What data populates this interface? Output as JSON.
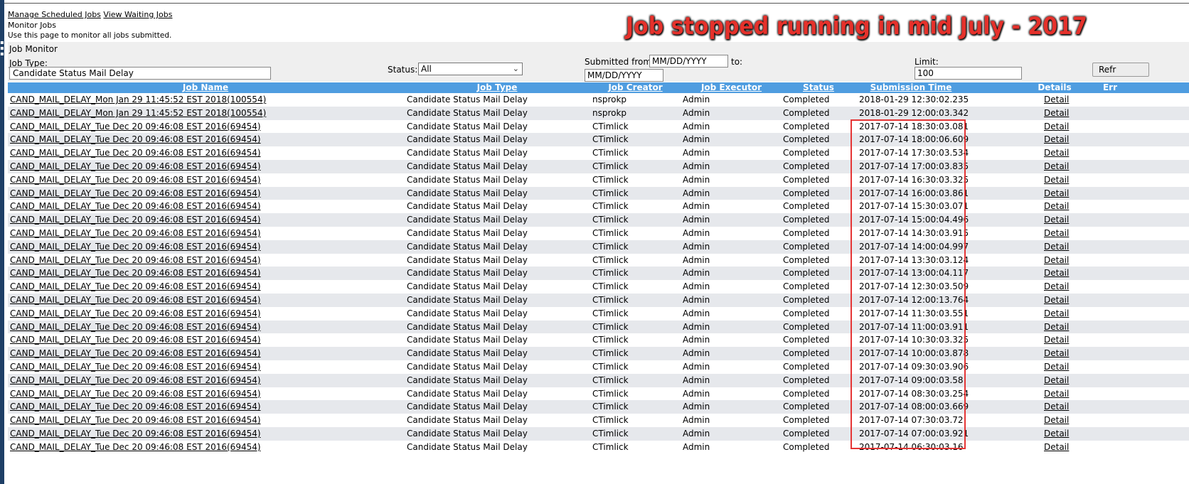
{
  "nav": {
    "manage_scheduled_jobs": "Manage Scheduled Jobs",
    "view_waiting_jobs": "View Waiting Jobs"
  },
  "page": {
    "subtitle": "Monitor Jobs",
    "description": "Use this page to monitor all jobs submitted."
  },
  "annotation": {
    "text": "Job stopped running in mid July - 2017",
    "color": "#e5312b"
  },
  "filters": {
    "panel_title": "Job Monitor",
    "job_type_label": "Job Type:",
    "job_type_value": "Candidate Status Mail Delay",
    "status_label": "Status:",
    "status_value": "All",
    "submitted_from_label": "Submitted from:",
    "submitted_from_value": "MM/DD/YYYY",
    "to_label": "to:",
    "to_value": "MM/DD/YYYY",
    "limit_label": "Limit:",
    "limit_value": "100",
    "refresh_label": "Refr"
  },
  "table": {
    "header_color": "#4f9de0",
    "columns": {
      "job_name": "Job Name",
      "job_type": "Job Type",
      "job_creator": "Job Creator",
      "job_executor": "Job Executor",
      "status": "Status",
      "submission_time": "Submission Time",
      "details": "Details",
      "errors": "Err"
    },
    "rows": [
      {
        "job_name": "CAND_MAIL_DELAY_Mon Jan 29 11:45:52 EST 2018(100554)",
        "job_type": "Candidate Status Mail Delay",
        "creator": "nsprokp",
        "executor": "Admin",
        "status": "Completed",
        "time": "2018-01-29 12:30:02.235",
        "details": "Detail"
      },
      {
        "job_name": "CAND_MAIL_DELAY_Mon Jan 29 11:45:52 EST 2018(100554)",
        "job_type": "Candidate Status Mail Delay",
        "creator": "nsprokp",
        "executor": "Admin",
        "status": "Completed",
        "time": "2018-01-29 12:00:03.342",
        "details": "Detail"
      },
      {
        "job_name": "CAND_MAIL_DELAY_Tue Dec 20 09:46:08 EST 2016(69454)",
        "job_type": "Candidate Status Mail Delay",
        "creator": "CTimlick",
        "executor": "Admin",
        "status": "Completed",
        "time": "2017-07-14 18:30:03.081",
        "details": "Detail"
      },
      {
        "job_name": "CAND_MAIL_DELAY_Tue Dec 20 09:46:08 EST 2016(69454)",
        "job_type": "Candidate Status Mail Delay",
        "creator": "CTimlick",
        "executor": "Admin",
        "status": "Completed",
        "time": "2017-07-14 18:00:06.609",
        "details": "Detail"
      },
      {
        "job_name": "CAND_MAIL_DELAY_Tue Dec 20 09:46:08 EST 2016(69454)",
        "job_type": "Candidate Status Mail Delay",
        "creator": "CTimlick",
        "executor": "Admin",
        "status": "Completed",
        "time": "2017-07-14 17:30:03.534",
        "details": "Detail"
      },
      {
        "job_name": "CAND_MAIL_DELAY_Tue Dec 20 09:46:08 EST 2016(69454)",
        "job_type": "Candidate Status Mail Delay",
        "creator": "CTimlick",
        "executor": "Admin",
        "status": "Completed",
        "time": "2017-07-14 17:00:03.835",
        "details": "Detail"
      },
      {
        "job_name": "CAND_MAIL_DELAY_Tue Dec 20 09:46:08 EST 2016(69454)",
        "job_type": "Candidate Status Mail Delay",
        "creator": "CTimlick",
        "executor": "Admin",
        "status": "Completed",
        "time": "2017-07-14 16:30:03.325",
        "details": "Detail"
      },
      {
        "job_name": "CAND_MAIL_DELAY_Tue Dec 20 09:46:08 EST 2016(69454)",
        "job_type": "Candidate Status Mail Delay",
        "creator": "CTimlick",
        "executor": "Admin",
        "status": "Completed",
        "time": "2017-07-14 16:00:03.861",
        "details": "Detail"
      },
      {
        "job_name": "CAND_MAIL_DELAY_Tue Dec 20 09:46:08 EST 2016(69454)",
        "job_type": "Candidate Status Mail Delay",
        "creator": "CTimlick",
        "executor": "Admin",
        "status": "Completed",
        "time": "2017-07-14 15:30:03.071",
        "details": "Detail"
      },
      {
        "job_name": "CAND_MAIL_DELAY_Tue Dec 20 09:46:08 EST 2016(69454)",
        "job_type": "Candidate Status Mail Delay",
        "creator": "CTimlick",
        "executor": "Admin",
        "status": "Completed",
        "time": "2017-07-14 15:00:04.496",
        "details": "Detail"
      },
      {
        "job_name": "CAND_MAIL_DELAY_Tue Dec 20 09:46:08 EST 2016(69454)",
        "job_type": "Candidate Status Mail Delay",
        "creator": "CTimlick",
        "executor": "Admin",
        "status": "Completed",
        "time": "2017-07-14 14:30:03.915",
        "details": "Detail"
      },
      {
        "job_name": "CAND_MAIL_DELAY_Tue Dec 20 09:46:08 EST 2016(69454)",
        "job_type": "Candidate Status Mail Delay",
        "creator": "CTimlick",
        "executor": "Admin",
        "status": "Completed",
        "time": "2017-07-14 14:00:04.997",
        "details": "Detail"
      },
      {
        "job_name": "CAND_MAIL_DELAY_Tue Dec 20 09:46:08 EST 2016(69454)",
        "job_type": "Candidate Status Mail Delay",
        "creator": "CTimlick",
        "executor": "Admin",
        "status": "Completed",
        "time": "2017-07-14 13:30:03.124",
        "details": "Detail"
      },
      {
        "job_name": "CAND_MAIL_DELAY_Tue Dec 20 09:46:08 EST 2016(69454)",
        "job_type": "Candidate Status Mail Delay",
        "creator": "CTimlick",
        "executor": "Admin",
        "status": "Completed",
        "time": "2017-07-14 13:00:04.117",
        "details": "Detail"
      },
      {
        "job_name": "CAND_MAIL_DELAY_Tue Dec 20 09:46:08 EST 2016(69454)",
        "job_type": "Candidate Status Mail Delay",
        "creator": "CTimlick",
        "executor": "Admin",
        "status": "Completed",
        "time": "2017-07-14 12:30:03.509",
        "details": "Detail"
      },
      {
        "job_name": "CAND_MAIL_DELAY_Tue Dec 20 09:46:08 EST 2016(69454)",
        "job_type": "Candidate Status Mail Delay",
        "creator": "CTimlick",
        "executor": "Admin",
        "status": "Completed",
        "time": "2017-07-14 12:00:13.764",
        "details": "Detail"
      },
      {
        "job_name": "CAND_MAIL_DELAY_Tue Dec 20 09:46:08 EST 2016(69454)",
        "job_type": "Candidate Status Mail Delay",
        "creator": "CTimlick",
        "executor": "Admin",
        "status": "Completed",
        "time": "2017-07-14 11:30:03.551",
        "details": "Detail"
      },
      {
        "job_name": "CAND_MAIL_DELAY_Tue Dec 20 09:46:08 EST 2016(69454)",
        "job_type": "Candidate Status Mail Delay",
        "creator": "CTimlick",
        "executor": "Admin",
        "status": "Completed",
        "time": "2017-07-14 11:00:03.911",
        "details": "Detail"
      },
      {
        "job_name": "CAND_MAIL_DELAY_Tue Dec 20 09:46:08 EST 2016(69454)",
        "job_type": "Candidate Status Mail Delay",
        "creator": "CTimlick",
        "executor": "Admin",
        "status": "Completed",
        "time": "2017-07-14 10:30:03.325",
        "details": "Detail"
      },
      {
        "job_name": "CAND_MAIL_DELAY_Tue Dec 20 09:46:08 EST 2016(69454)",
        "job_type": "Candidate Status Mail Delay",
        "creator": "CTimlick",
        "executor": "Admin",
        "status": "Completed",
        "time": "2017-07-14 10:00:03.878",
        "details": "Detail"
      },
      {
        "job_name": "CAND_MAIL_DELAY_Tue Dec 20 09:46:08 EST 2016(69454)",
        "job_type": "Candidate Status Mail Delay",
        "creator": "CTimlick",
        "executor": "Admin",
        "status": "Completed",
        "time": "2017-07-14 09:30:03.906",
        "details": "Detail"
      },
      {
        "job_name": "CAND_MAIL_DELAY_Tue Dec 20 09:46:08 EST 2016(69454)",
        "job_type": "Candidate Status Mail Delay",
        "creator": "CTimlick",
        "executor": "Admin",
        "status": "Completed",
        "time": "2017-07-14 09:00:03.58",
        "details": "Detail"
      },
      {
        "job_name": "CAND_MAIL_DELAY_Tue Dec 20 09:46:08 EST 2016(69454)",
        "job_type": "Candidate Status Mail Delay",
        "creator": "CTimlick",
        "executor": "Admin",
        "status": "Completed",
        "time": "2017-07-14 08:30:03.254",
        "details": "Detail"
      },
      {
        "job_name": "CAND_MAIL_DELAY_Tue Dec 20 09:46:08 EST 2016(69454)",
        "job_type": "Candidate Status Mail Delay",
        "creator": "CTimlick",
        "executor": "Admin",
        "status": "Completed",
        "time": "2017-07-14 08:00:03.669",
        "details": "Detail"
      },
      {
        "job_name": "CAND_MAIL_DELAY_Tue Dec 20 09:46:08 EST 2016(69454)",
        "job_type": "Candidate Status Mail Delay",
        "creator": "CTimlick",
        "executor": "Admin",
        "status": "Completed",
        "time": "2017-07-14 07:30:03.72",
        "details": "Detail"
      },
      {
        "job_name": "CAND_MAIL_DELAY_Tue Dec 20 09:46:08 EST 2016(69454)",
        "job_type": "Candidate Status Mail Delay",
        "creator": "CTimlick",
        "executor": "Admin",
        "status": "Completed",
        "time": "2017-07-14 07:00:03.921",
        "details": "Detail"
      },
      {
        "job_name": "CAND_MAIL_DELAY_Tue Dec 20 09:46:08 EST 2016(69454)",
        "job_type": "Candidate Status Mail Delay",
        "creator": "CTimlick",
        "executor": "Admin",
        "status": "Completed",
        "time": "2017-07-14 06:30:03.16",
        "details": "Detail"
      }
    ]
  },
  "highlight_color": "#e53535"
}
